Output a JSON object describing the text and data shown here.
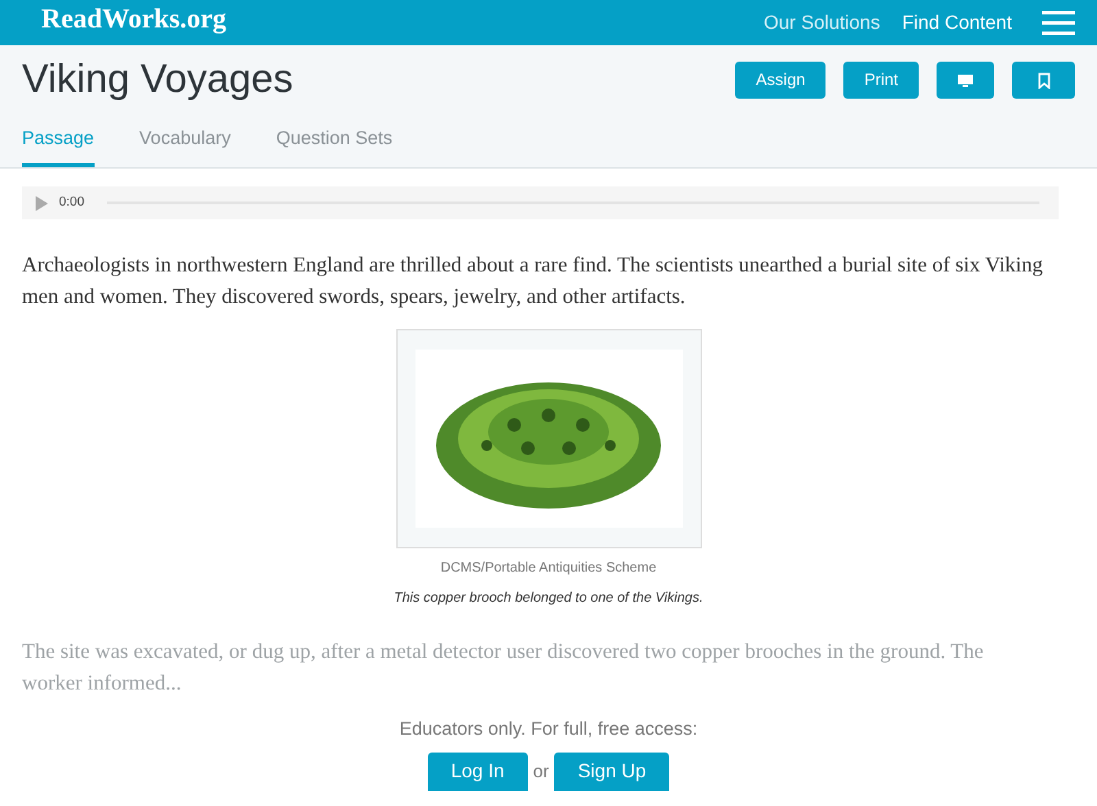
{
  "header": {
    "logo": "ReadWorks.org",
    "nav": [
      "Our Solutions",
      "Find Content"
    ]
  },
  "title": "Viking Voyages",
  "actions": [
    {
      "kind": "text",
      "label": "Assign"
    },
    {
      "kind": "text",
      "label": "Print"
    },
    {
      "kind": "monitor"
    },
    {
      "kind": "bookmark"
    }
  ],
  "tabs": [
    {
      "label": "Passage",
      "selected": true
    },
    {
      "label": "Vocabulary",
      "selected": false
    },
    {
      "label": "Question Sets",
      "selected": false
    }
  ],
  "audio": {
    "time": "0:00"
  },
  "paragraph": "Archaeologists in northwestern England are thrilled about a rare find. The scientists unearthed a burial site of six Viking men and women. They discovered swords, spears, jewelry, and other artifacts.",
  "figure": {
    "credit": "DCMS/Portable Antiquities Scheme",
    "caption": "This copper brooch belonged to one of the Vikings."
  },
  "faded_paragraph": "The site was excavated, or dug up, after a metal detector user discovered two copper brooches in the ground. The worker informed...",
  "access": {
    "message": "Educators only. For full, free access:",
    "login": "Log In",
    "separator": "or",
    "signup": "Sign Up"
  }
}
